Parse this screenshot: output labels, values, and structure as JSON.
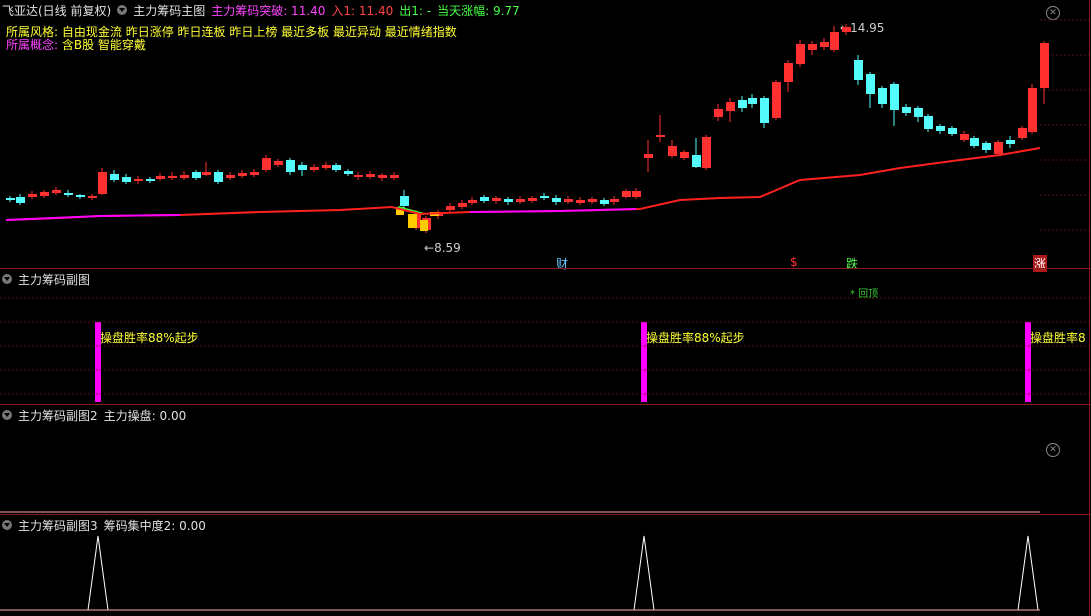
{
  "main": {
    "stock_title": "飞亚达(日线 前复权)",
    "indicator_name": "主力筹码主图",
    "breakout_label": "主力筹码突破: 11.40",
    "buy_label": "入1: 11.40",
    "sell_label": "出1: -",
    "change_label": "当天涨幅: 9.77",
    "style_label": "所属风格:",
    "style_value": "自由现金流 昨日涨停 昨日连板 昨日上榜 最近多板 最近异动 最近情绪指数",
    "concept_label": "所属概念:",
    "concept_value": "含B股 智能穿戴",
    "high_price": "14.95",
    "low_price": "8.59",
    "marker_cai": "财",
    "marker_s": "$",
    "marker_die": "跌",
    "marker_zhang": "涨",
    "sub_marker": "* 回顶"
  },
  "sub1": {
    "title": "主力筹码副图",
    "signal_text": "操盘胜率88%起步",
    "signal_text_cut": "操盘胜率8"
  },
  "sub2": {
    "title": "主力筹码副图2",
    "value_label": "主力操盘: 0.00"
  },
  "sub3": {
    "title": "主力筹码副图3",
    "value_label": "筹码集中度2: 0.00"
  },
  "colors": {
    "up": "#ff3030",
    "down": "#54fcfc",
    "ma": "#ff2020",
    "purple": "#ff00ff",
    "yellow": "#ffff33",
    "border": "#8a1a1a"
  },
  "icons": {
    "collapse": "chevron-down-icon",
    "close": "close-icon"
  }
}
